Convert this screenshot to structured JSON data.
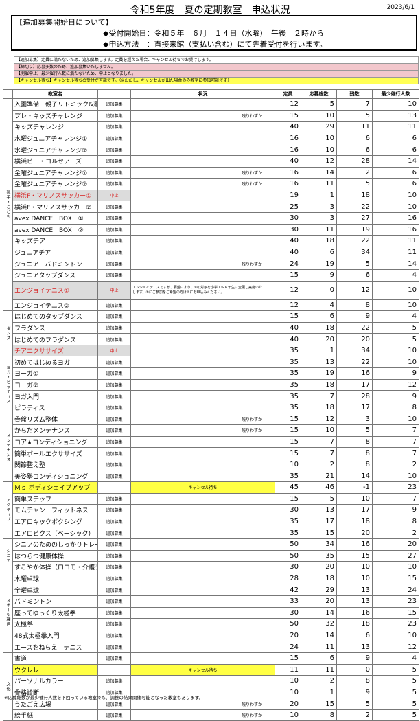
{
  "header": {
    "title": "令和5年度　夏の定期教室　申込状況",
    "date": "2023/6/1"
  },
  "info": {
    "heading": "【追加募集開始日について】",
    "line1": "◆受付開始日：令和５年　６月　１４日（水曜）　午後　２時から",
    "line2": "◆申込方法　：直接来館（支払い含む）にて先着受付を行います。"
  },
  "notes": [
    "【追加募集】定員に満たないため、追加募集します。定員を超えた場合、キャンセル待ちでお受けします。",
    "【締切り】応募多数のため、追加募集いたしません。",
    "【開催中止】最少催行人数に満たないため、中止となりました。",
    "【キャンセル待ち】キャンセル待ちの受付が可能です。（※ただし、キャンセルが出た場合のみ教室に参加可能です）"
  ],
  "columns": [
    "教室名",
    "",
    "状況",
    "定員",
    "応募総数",
    "残数",
    "最少催行人数"
  ],
  "categories": [
    {
      "label": "親子・こども",
      "rows": [
        {
          "name": "入園準備　親子リトミック&運動",
          "status": "追加募集",
          "sit": "",
          "cap": 12,
          "apps": 5,
          "rem": 7,
          "min": 10
        },
        {
          "name": "プレ・キッズチャレンジ",
          "status": "追加募集",
          "sit": "残りわずか",
          "cap": 15,
          "apps": 10,
          "rem": 5,
          "min": 13
        },
        {
          "name": "キッズチャレンジ",
          "status": "追加募集",
          "sit": "",
          "cap": 40,
          "apps": 29,
          "rem": 11,
          "min": 11
        },
        {
          "name": "水曜ジュニアチャレンジ①",
          "status": "追加募集",
          "sit": "",
          "cap": 16,
          "apps": 10,
          "rem": 6,
          "min": 6
        },
        {
          "name": "水曜ジュニアチャレンジ②",
          "status": "追加募集",
          "sit": "",
          "cap": 16,
          "apps": 10,
          "rem": 6,
          "min": 6
        },
        {
          "name": "横浜ビー・コルセアーズ",
          "status": "追加募集",
          "sit": "",
          "cap": 40,
          "apps": 12,
          "rem": 28,
          "min": 14
        },
        {
          "name": "金曜ジュニアチャレンジ①",
          "status": "追加募集",
          "sit": "残りわずか",
          "cap": 16,
          "apps": 14,
          "rem": 2,
          "min": 6
        },
        {
          "name": "金曜ジュニアチャレンジ②",
          "status": "追加募集",
          "sit": "残りわずか",
          "cap": 16,
          "apps": 11,
          "rem": 5,
          "min": 6
        },
        {
          "name": "横浜F・マリノスサッカー①",
          "status": "中止",
          "sit": "",
          "cap": 19,
          "apps": 1,
          "rem": 18,
          "min": 10,
          "style": "pink red"
        },
        {
          "name": "横浜F・マリノスサッカー②",
          "status": "追加募集",
          "sit": "",
          "cap": 25,
          "apps": 3,
          "rem": 22,
          "min": 10
        },
        {
          "name": "avex DANCE　BOX　①",
          "status": "追加募集",
          "sit": "",
          "cap": 30,
          "apps": 3,
          "rem": 27,
          "min": 16
        },
        {
          "name": "avex DANCE　BOX　②",
          "status": "追加募集",
          "sit": "",
          "cap": 30,
          "apps": 11,
          "rem": 19,
          "min": 16
        },
        {
          "name": "キッズチア",
          "status": "追加募集",
          "sit": "",
          "cap": 40,
          "apps": 18,
          "rem": 22,
          "min": 11
        },
        {
          "name": "ジュニアチア",
          "status": "追加募集",
          "sit": "",
          "cap": 40,
          "apps": 6,
          "rem": 34,
          "min": 11
        },
        {
          "name": "ジュニア　バドミントン",
          "status": "追加募集",
          "sit": "残りわずか",
          "cap": 24,
          "apps": 19,
          "rem": 5,
          "min": 14
        },
        {
          "name": "ジュニアタップダンス",
          "status": "追加募集",
          "sit": "",
          "cap": 15,
          "apps": 9,
          "rem": 6,
          "min": 4
        },
        {
          "name": "エンジョイテニス①",
          "status": "中止",
          "sit": "エンジョイテニスですが、要望により、②の対象を小学１～６年生に変更し実施いたします。①にご参加をご希望の方は②にお申込みください。",
          "cap": 12,
          "apps": 0,
          "rem": 12,
          "min": 10,
          "style": "pink red tall",
          "sitClass": "small"
        },
        {
          "name": "エンジョイテニス②",
          "status": "追加募集",
          "sit": "",
          "cap": 12,
          "apps": 4,
          "rem": 8,
          "min": 10
        }
      ]
    },
    {
      "label": "ダンス",
      "rows": [
        {
          "name": "はじめてのタップダンス",
          "status": "追加募集",
          "sit": "",
          "cap": 15,
          "apps": 6,
          "rem": 9,
          "min": 4
        },
        {
          "name": "フラダンス",
          "status": "追加募集",
          "sit": "",
          "cap": 40,
          "apps": 18,
          "rem": 22,
          "min": 5
        },
        {
          "name": "はじめてのフラダンス",
          "status": "追加募集",
          "sit": "",
          "cap": 40,
          "apps": 20,
          "rem": 20,
          "min": 5
        },
        {
          "name": "チアエクササイズ",
          "status": "中止",
          "sit": "",
          "cap": 35,
          "apps": 1,
          "rem": 34,
          "min": 10,
          "style": "pink red"
        }
      ]
    },
    {
      "label": "ヨガ・ピラティス",
      "rows": [
        {
          "name": "初めてはじめるヨガ",
          "status": "追加募集",
          "sit": "",
          "cap": 35,
          "apps": 13,
          "rem": 22,
          "min": 10
        },
        {
          "name": "ヨーガ①",
          "status": "追加募集",
          "sit": "",
          "cap": 35,
          "apps": 19,
          "rem": 16,
          "min": 9
        },
        {
          "name": "ヨーガ②",
          "status": "追加募集",
          "sit": "",
          "cap": 35,
          "apps": 18,
          "rem": 17,
          "min": 12
        },
        {
          "name": "ヨガ入門",
          "status": "追加募集",
          "sit": "",
          "cap": 35,
          "apps": 7,
          "rem": 28,
          "min": 9
        },
        {
          "name": "ピラティス",
          "status": "追加募集",
          "sit": "",
          "cap": 35,
          "apps": 18,
          "rem": 17,
          "min": 8
        }
      ]
    },
    {
      "label": "メンテナンス",
      "rows": [
        {
          "name": "骨盤リズム整体",
          "status": "追加募集",
          "sit": "残りわずか",
          "cap": 15,
          "apps": 12,
          "rem": 3,
          "min": 10
        },
        {
          "name": "からだメンテナンス",
          "status": "追加募集",
          "sit": "残りわずか",
          "cap": 15,
          "apps": 10,
          "rem": 5,
          "min": 7
        },
        {
          "name": "コア★コンディショニング",
          "status": "追加募集",
          "sit": "",
          "cap": 15,
          "apps": 7,
          "rem": 8,
          "min": 7
        },
        {
          "name": "簡単ボールエクササイズ",
          "status": "追加募集",
          "sit": "",
          "cap": 15,
          "apps": 7,
          "rem": 8,
          "min": 7
        },
        {
          "name": "関節整え塾",
          "status": "追加募集",
          "sit": "",
          "cap": 10,
          "apps": 2,
          "rem": 8,
          "min": 2
        },
        {
          "name": "美姿勢コンディショニング",
          "status": "追加募集",
          "sit": "",
          "cap": 35,
          "apps": 21,
          "rem": 14,
          "min": 10
        }
      ]
    },
    {
      "label": "アクティブ",
      "rows": [
        {
          "name": "Ｍｓ ボディシェイプアップ",
          "status": "",
          "sit": "キャンセル待ち",
          "cap": 45,
          "apps": 46,
          "rem": -1,
          "min": 23,
          "style": "yellow",
          "sitClass": "center"
        },
        {
          "name": "簡単ステップ",
          "status": "追加募集",
          "sit": "",
          "cap": 15,
          "apps": 5,
          "rem": 10,
          "min": 7
        },
        {
          "name": "モムチャン　フィットネス",
          "status": "追加募集",
          "sit": "",
          "cap": 30,
          "apps": 13,
          "rem": 17,
          "min": 9
        },
        {
          "name": "エアロキックボクシング",
          "status": "追加募集",
          "sit": "",
          "cap": 35,
          "apps": 17,
          "rem": 18,
          "min": 8
        },
        {
          "name": "エアロビクス（ベーシック）",
          "status": "追加募集",
          "sit": "",
          "cap": 35,
          "apps": 15,
          "rem": 20,
          "min": 2
        }
      ]
    },
    {
      "label": "シニア",
      "rows": [
        {
          "name": "シニアのためのしっかりトレーニング",
          "status": "追加募集",
          "sit": "",
          "cap": 50,
          "apps": 34,
          "rem": 16,
          "min": 20
        },
        {
          "name": "はつらつ健康体操",
          "status": "追加募集",
          "sit": "",
          "cap": 50,
          "apps": 35,
          "rem": 15,
          "min": 27
        },
        {
          "name": "すこやか体操（ロコモ・介護予防）",
          "status": "追加募集",
          "sit": "",
          "cap": 30,
          "apps": 20,
          "rem": 10,
          "min": 10
        }
      ]
    },
    {
      "label": "スポーツ種目",
      "rows": [
        {
          "name": "木曜卓球",
          "status": "追加募集",
          "sit": "",
          "cap": 28,
          "apps": 18,
          "rem": 10,
          "min": 15
        },
        {
          "name": "金曜卓球",
          "status": "追加募集",
          "sit": "",
          "cap": 42,
          "apps": 29,
          "rem": 13,
          "min": 24
        },
        {
          "name": "バドミントン",
          "status": "追加募集",
          "sit": "",
          "cap": 33,
          "apps": 20,
          "rem": 13,
          "min": 23
        },
        {
          "name": "座ってゆっくり太極拳",
          "status": "追加募集",
          "sit": "",
          "cap": 30,
          "apps": 14,
          "rem": 16,
          "min": 15
        },
        {
          "name": "太極拳",
          "status": "追加募集",
          "sit": "",
          "cap": 50,
          "apps": 32,
          "rem": 18,
          "min": 23
        },
        {
          "name": "48式太極拳入門",
          "status": "追加募集",
          "sit": "",
          "cap": 20,
          "apps": 14,
          "rem": 6,
          "min": 10
        },
        {
          "name": "エースをねらえ　テニス",
          "status": "追加募集",
          "sit": "",
          "cap": 24,
          "apps": 11,
          "rem": 13,
          "min": 12
        }
      ]
    },
    {
      "label": "文化",
      "rows": [
        {
          "name": "書道",
          "status": "追加募集",
          "sit": "",
          "cap": 15,
          "apps": 6,
          "rem": 9,
          "min": 4
        },
        {
          "name": "ウクレレ",
          "status": "",
          "sit": "キャンセル待ち",
          "cap": 11,
          "apps": 11,
          "rem": 0,
          "min": 5,
          "style": "yellow",
          "sitClass": "center"
        },
        {
          "name": "パーソナルカラー",
          "status": "追加募集",
          "sit": "",
          "cap": 10,
          "apps": 2,
          "rem": 8,
          "min": 5
        },
        {
          "name": "骨格診断",
          "status": "追加募集",
          "sit": "",
          "cap": 10,
          "apps": 1,
          "rem": 9,
          "min": 5
        },
        {
          "name": "うたごえ広場",
          "status": "追加募集",
          "sit": "残りわずか",
          "cap": 20,
          "apps": 15,
          "rem": 5,
          "min": 5
        },
        {
          "name": "絵手紙",
          "status": "追加募集",
          "sit": "残りわずか",
          "cap": 10,
          "apps": 8,
          "rem": 2,
          "min": 5
        }
      ]
    }
  ],
  "footer": "※応募総数が最少催行人数を下回っている教室でも、調整の結果開催可能となった教室もあります。"
}
